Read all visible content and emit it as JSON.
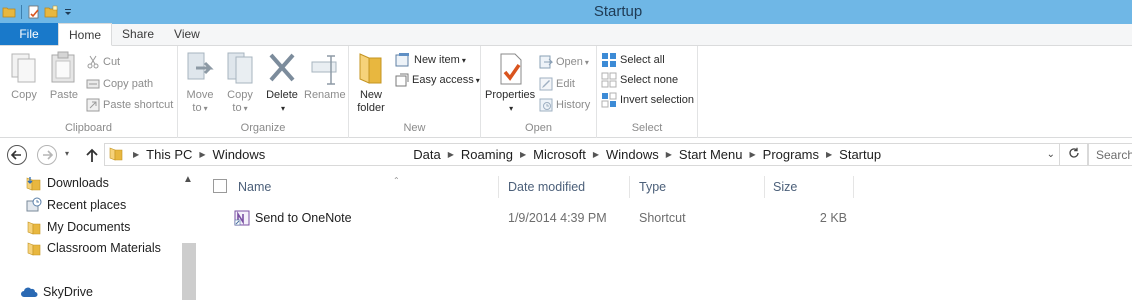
{
  "window": {
    "title": "Startup",
    "qat_icons": [
      "folder-icon",
      "properties-icon",
      "new-folder-icon",
      "customize-qat-icon"
    ]
  },
  "ribbon_tabs": [
    {
      "label": "File"
    },
    {
      "label": "Home"
    },
    {
      "label": "Share"
    },
    {
      "label": "View"
    }
  ],
  "ribbon": {
    "clipboard": {
      "label": "Clipboard",
      "copy": "Copy",
      "paste": "Paste",
      "cut": "Cut",
      "copy_path": "Copy path",
      "paste_shortcut": "Paste shortcut"
    },
    "organize": {
      "label": "Organize",
      "move_to": "Move",
      "move_to_sub": "to",
      "copy_to": "Copy",
      "copy_to_sub": "to",
      "delete": "Delete",
      "rename": "Rename"
    },
    "new": {
      "label": "New",
      "new_folder": "New",
      "new_folder_sub": "folder",
      "new_item": "New item",
      "easy_access": "Easy access"
    },
    "open": {
      "label": "Open",
      "properties": "Properties",
      "open": "Open",
      "edit": "Edit",
      "history": "History"
    },
    "select": {
      "label": "Select",
      "select_all": "Select all",
      "select_none": "Select none",
      "invert_selection": "Invert selection"
    }
  },
  "address": {
    "crumbs": [
      "This PC",
      "Windows",
      "",
      "Data",
      "Roaming",
      "Microsoft",
      "Windows",
      "Start Menu",
      "Programs",
      "Startup"
    ],
    "search_placeholder": "Search"
  },
  "nav_pane": {
    "items": [
      {
        "label": "Downloads",
        "icon": "downloads-icon"
      },
      {
        "label": "Recent places",
        "icon": "recent-places-icon"
      },
      {
        "label": "My Documents",
        "icon": "folder-icon"
      },
      {
        "label": "Classroom Materials",
        "icon": "folder-icon"
      },
      {
        "label": "SkyDrive",
        "icon": "skydrive-icon"
      }
    ]
  },
  "file_list": {
    "columns": [
      "Name",
      "Date modified",
      "Type",
      "Size"
    ],
    "rows": [
      {
        "name": "Send to OneNote",
        "date_modified": "1/9/2014 4:39 PM",
        "type": "Shortcut",
        "size": "2 KB",
        "icon": "onenote-shortcut-icon"
      }
    ]
  },
  "colors": {
    "titlebar": "#6fb7e6",
    "file_tab": "#1979ca",
    "folder_yellow": "#e8b73f"
  }
}
